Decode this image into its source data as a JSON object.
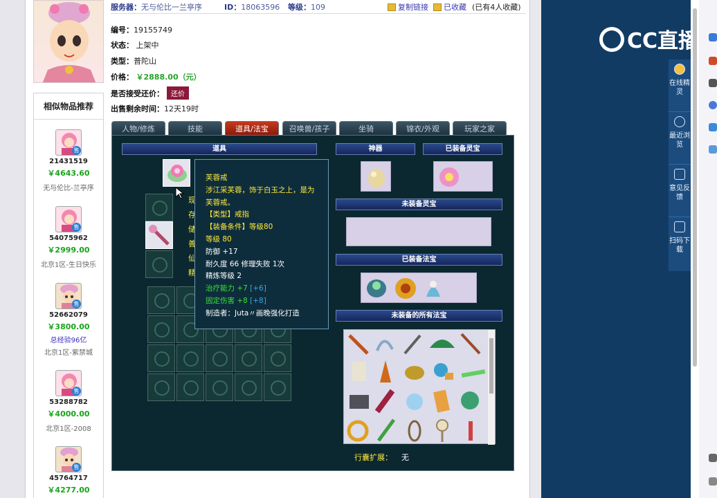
{
  "header": {
    "server_label": "服务器：",
    "server_value": "无与伦比一兰亭序",
    "id_label": "ID：",
    "id_value": "18063596",
    "level_label": "等级：",
    "level_value": "109",
    "copy_link": "复制链接",
    "favorited": "已收藏",
    "fav_count": "(已有4人收藏)"
  },
  "info": {
    "serial_label": "编号：",
    "serial_value": "19155749",
    "status_label": "状态：",
    "status_value": "上架中",
    "type_label": "类型：",
    "type_value": "普陀山",
    "price_label": "价格：",
    "price_value": "￥2888.00（元）",
    "bargain_label": "是否接受还价：",
    "bargain_button": "还价",
    "time_label": "出售剩余时间：",
    "time_value": "12天19时"
  },
  "sidebar": {
    "title": "相似物品推荐",
    "sell_badge": "售",
    "items": [
      {
        "id": "21431519",
        "price": "￥4643.60",
        "server": "无与伦比-兰亭序",
        "extra": ""
      },
      {
        "id": "54075962",
        "price": "￥2999.00",
        "server": "北京1区-生日快乐",
        "extra": ""
      },
      {
        "id": "52662079",
        "price": "￥3800.00",
        "server": "北京1区-紫禁城",
        "extra": "总经验96亿"
      },
      {
        "id": "53288782",
        "price": "￥4000.00",
        "server": "北京1区-2008",
        "extra": ""
      },
      {
        "id": "45764717",
        "price": "￥4277.00",
        "server": "",
        "extra": ""
      }
    ]
  },
  "tabs": [
    "人物/修炼",
    "技能",
    "道具/法宝",
    "召唤兽/孩子",
    "坐骑",
    "锦衣/外观",
    "玩家之家"
  ],
  "panel": {
    "props_bar": "道具",
    "artifact_bar": "神器",
    "equipped_spirit_bar": "已装备灵宝",
    "unequipped_spirit_bar": "未装备灵宝",
    "equipped_treasure_bar": "已装备法宝",
    "all_unequipped_bar": "未装备的所有法宝",
    "bag_ext_label": "行囊扩展：",
    "bag_ext_value": "无",
    "left_labels": [
      "现",
      "存",
      "储",
      "善",
      "仙",
      "精"
    ]
  },
  "tooltip": {
    "name": "芙蓉戒",
    "desc": "涉江采芙蓉，饰于白玉之上，是为芙蓉戒。",
    "type": "【类型】戒指",
    "req": "【装备条件】等级80",
    "level": "等级 80",
    "defense": "防御 +17",
    "durability": "耐久度 66 修理失败 1次",
    "refine": "精炼等级 2",
    "heal": "治疗能力 +7",
    "heal_extra": " [+6]",
    "fixed": "固定伤害 +8",
    "fixed_extra": " [+8]",
    "maker": "制造者：Juta〃画晚强化打造"
  },
  "right": {
    "logo": "CC直播",
    "tools": [
      "在线精灵",
      "最近浏览",
      "意见反馈",
      "扫码下载"
    ]
  },
  "colors": {
    "price_green": "#1aa31a",
    "panel_bg": "#0b2830",
    "tab_active": "#c43a1c",
    "tooltip_yellow": "#ffea3a"
  }
}
